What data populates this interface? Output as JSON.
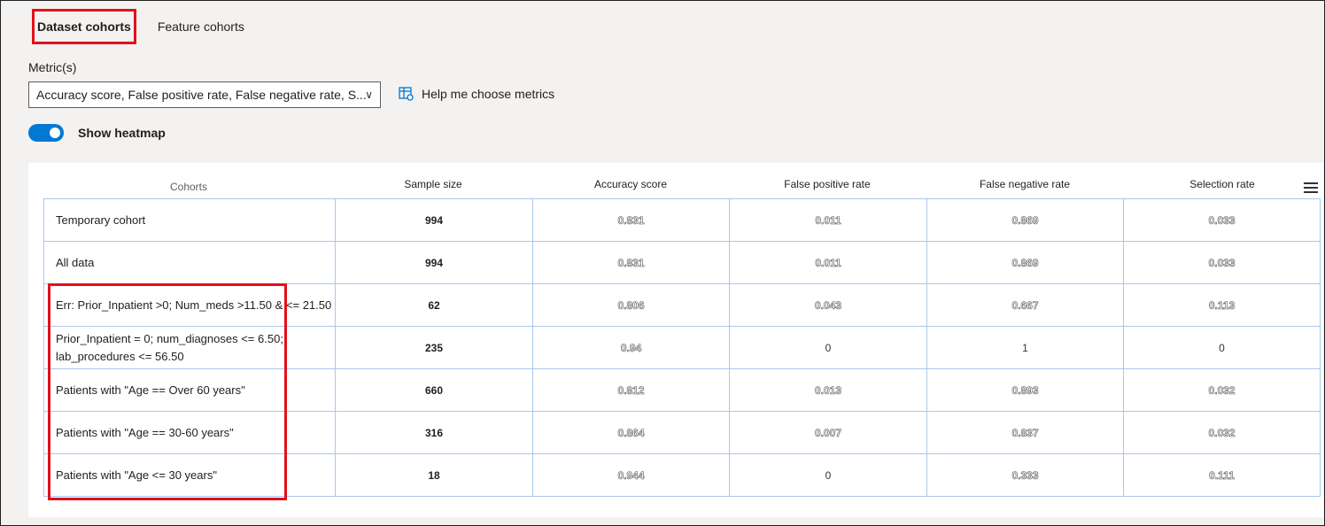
{
  "tabs": [
    {
      "label": "Dataset cohorts",
      "active": true
    },
    {
      "label": "Feature cohorts",
      "active": false
    }
  ],
  "metrics": {
    "label": "Metric(s)",
    "selected": "Accuracy score, False positive rate, False negative rate, S...",
    "help_link": "Help me choose metrics"
  },
  "heatmap": {
    "label": "Show heatmap",
    "enabled": true
  },
  "table": {
    "columns": [
      "Cohorts",
      "Sample size",
      "Accuracy score",
      "False positive rate",
      "False negative rate",
      "Selection rate"
    ],
    "rows": [
      {
        "cohort": "Temporary cohort",
        "size": "994",
        "acc": "0.831",
        "fpr": "0.011",
        "fnr": "0.869",
        "sel": "0.033"
      },
      {
        "cohort": "All data",
        "size": "994",
        "acc": "0.831",
        "fpr": "0.011",
        "fnr": "0.869",
        "sel": "0.033"
      },
      {
        "cohort": "Err: Prior_Inpatient >0; Num_meds >11.50 & <= 21.50",
        "size": "62",
        "acc": "0.806",
        "fpr": "0.043",
        "fnr": "0.667",
        "sel": "0.113"
      },
      {
        "cohort": "Prior_Inpatient = 0; num_diagnoses <= 6.50; lab_procedures <= 56.50",
        "size": "235",
        "acc": "0.94",
        "fpr": "0",
        "fnr": "1",
        "sel": "0"
      },
      {
        "cohort": "Patients with \"Age == Over 60 years\"",
        "size": "660",
        "acc": "0.812",
        "fpr": "0.013",
        "fnr": "0.893",
        "sel": "0.032"
      },
      {
        "cohort": "Patients with \"Age == 30-60 years\"",
        "size": "316",
        "acc": "0.864",
        "fpr": "0.007",
        "fnr": "0.837",
        "sel": "0.032"
      },
      {
        "cohort": "Patients with \"Age <= 30 years\"",
        "size": "18",
        "acc": "0.944",
        "fpr": "0",
        "fnr": "0.333",
        "sel": "0.111"
      }
    ]
  },
  "colors": {
    "accent": "#0078d4",
    "highlight": "#e3101a",
    "grid": "#a9c8ee"
  }
}
